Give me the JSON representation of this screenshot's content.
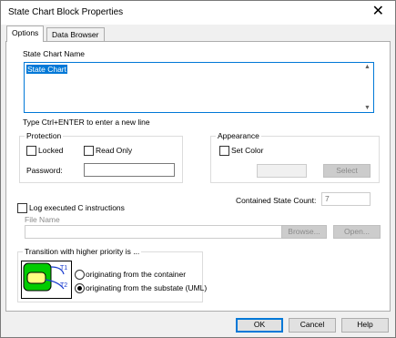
{
  "window": {
    "title": "State Chart Block Properties",
    "close_glyph": "✕"
  },
  "tabs": [
    {
      "label": "Options"
    },
    {
      "label": "Data Browser"
    }
  ],
  "name_section": {
    "label": "State Chart Name",
    "value": "State Chart",
    "hint": "Type Ctrl+ENTER to enter a new line"
  },
  "protection": {
    "label": "Protection",
    "locked_label": "Locked",
    "readonly_label": "Read Only",
    "password_label": "Password:"
  },
  "appearance": {
    "label": "Appearance",
    "set_color_label": "Set Color",
    "select_label": "Select"
  },
  "contained": {
    "label": "Contained State Count:",
    "value": "7"
  },
  "log": {
    "checkbox_label": "Log executed C instructions",
    "file_name_label": "File Name",
    "browse_label": "Browse...",
    "open_label": "Open..."
  },
  "transition": {
    "label": "Transition with higher priority is ...",
    "option_container": "originating from the container",
    "option_substate": "originating from the substate (UML)",
    "icon_t1": "T1",
    "icon_t2": "T2"
  },
  "buttons": {
    "ok": "OK",
    "cancel": "Cancel",
    "help": "Help"
  },
  "colors": {
    "accent": "#0078d7",
    "icon_green": "#00cc00",
    "icon_yellow": "#ffff80"
  }
}
